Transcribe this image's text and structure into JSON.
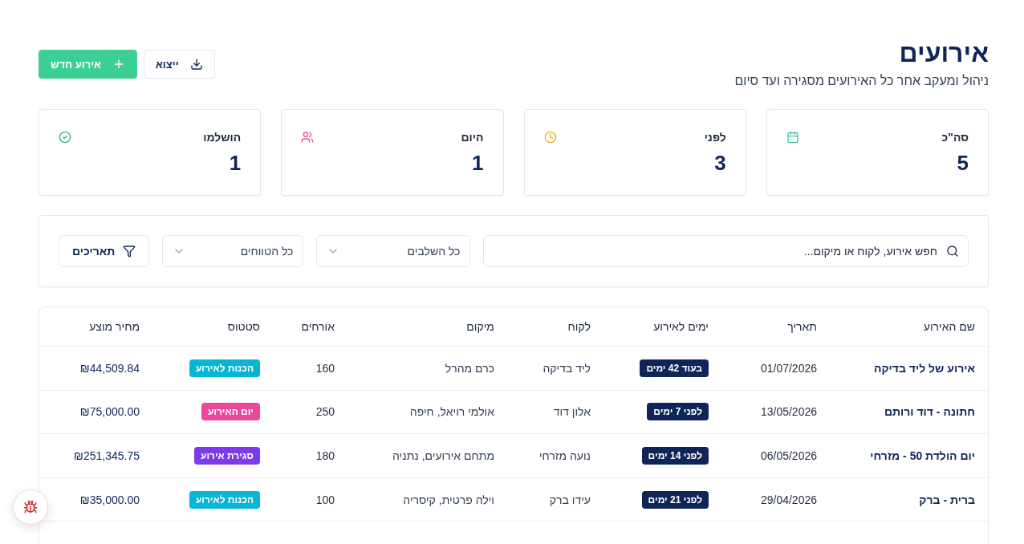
{
  "page": {
    "title": "אירועים",
    "subtitle": "ניהול ומעקב אחר כל האירועים מסגירה ועד סיום"
  },
  "actions": [
    {
      "label": "ייצוא",
      "kind": "export"
    },
    {
      "label": "אירוע חדש",
      "kind": "create"
    }
  ],
  "stats": [
    {
      "label": "סה\"כ",
      "value": "5",
      "kind": "total"
    },
    {
      "label": "לפני",
      "value": "3",
      "kind": "before"
    },
    {
      "label": "היום",
      "value": "1",
      "kind": "today"
    },
    {
      "label": "הושלמו",
      "value": "1",
      "kind": "done"
    }
  ],
  "filters": {
    "search": {
      "placeholder": "חפש אירוע, לקוח או מיקום..."
    },
    "selects": [
      {
        "value": "כל השלבים"
      },
      {
        "value": "כל הטווחים"
      }
    ],
    "dates_button": {
      "label": "תאריכים"
    }
  },
  "table": {
    "columns": [
      "שם האירוע",
      "תאריך",
      "ימים לאירוע",
      "לקוח",
      "מיקום",
      "אורחים",
      "סטטוס",
      "מחיר מוצע"
    ],
    "rows": [
      {
        "name": "אירוע של ליד בדיקה",
        "date": "01/07/2026",
        "days": "בעוד 42 ימים",
        "client": "ליד בדיקה",
        "location": "כרם מהרל",
        "guests": "160",
        "status": {
          "label": "הכנות לאירוע",
          "color": "#06b6d4"
        },
        "price": "₪44,509.84"
      },
      {
        "name": "חתונה - דוד ורותם",
        "date": "13/05/2026",
        "days": "לפני 7 ימים",
        "client": "אלון דוד",
        "location": "אולמי רויאל, חיפה",
        "guests": "250",
        "status": {
          "label": "יום האירוע",
          "color": "#ec4899"
        },
        "price": "₪75,000.00"
      },
      {
        "name": "יום הולדת 50 - מזרחי",
        "date": "06/05/2026",
        "days": "לפני 14 ימים",
        "client": "נועה מזרחי",
        "location": "מתחם אירועים, נתניה",
        "guests": "180",
        "status": {
          "label": "סגירת אירוע",
          "color": "#7c3aed"
        },
        "price": "₪251,345.75"
      },
      {
        "name": "ברית - ברק",
        "date": "29/04/2026",
        "days": "לפני 21 ימים",
        "client": "עידו ברק",
        "location": "וילה פרטית, קיסריה",
        "guests": "100",
        "status": {
          "label": "הכנות לאירוע",
          "color": "#06b6d4"
        },
        "price": "₪35,000.00"
      }
    ]
  }
}
